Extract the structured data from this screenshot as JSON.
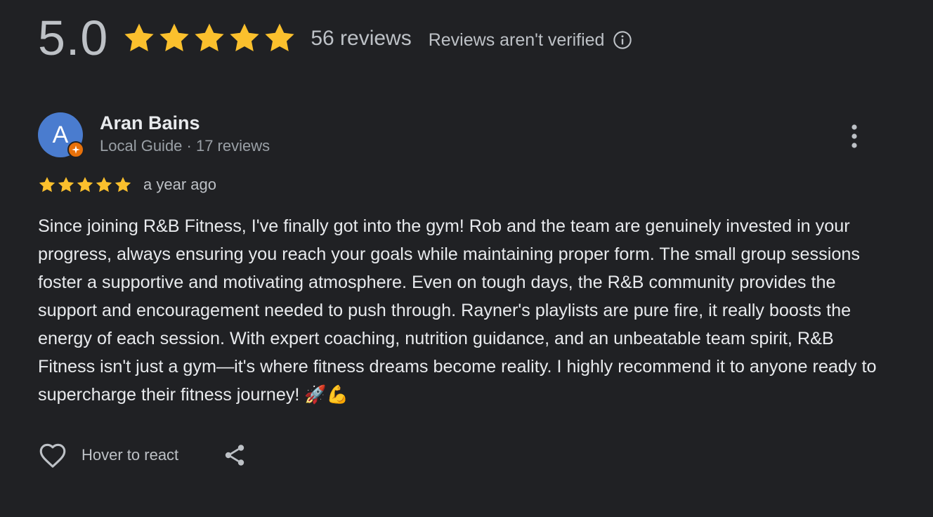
{
  "summary": {
    "rating": "5.0",
    "stars": 5,
    "review_count": "56 reviews",
    "verification_note": "Reviews aren't verified",
    "star_color": "#fbc02d"
  },
  "review": {
    "avatar_letter": "A",
    "avatar_color": "#4a7ccf",
    "badge_color": "#e8710a",
    "reviewer_name": "Aran Bains",
    "reviewer_meta": "Local Guide · 17 reviews",
    "stars": 5,
    "date": "a year ago",
    "text": "Since joining R&B Fitness, I've finally got into the gym! Rob and the team are genuinely invested in your progress, always ensuring you reach your goals while maintaining proper form. The small group sessions foster a supportive and motivating atmosphere. Even on tough days, the R&B community provides the support and encouragement needed to push through. Rayner's playlists are pure fire, it really boosts the energy of each session. With expert coaching, nutrition guidance, and an unbeatable team spirit, R&B Fitness isn't just a gym—it's where fitness dreams become reality. I highly recommend it to anyone ready to supercharge their fitness journey! 🚀💪",
    "react_label": "Hover to react"
  },
  "icons": {
    "info": "info-circle-icon",
    "more": "more-vertical-icon",
    "like": "heart-outline-icon",
    "share": "share-icon",
    "badge": "local-guide-star-icon"
  }
}
